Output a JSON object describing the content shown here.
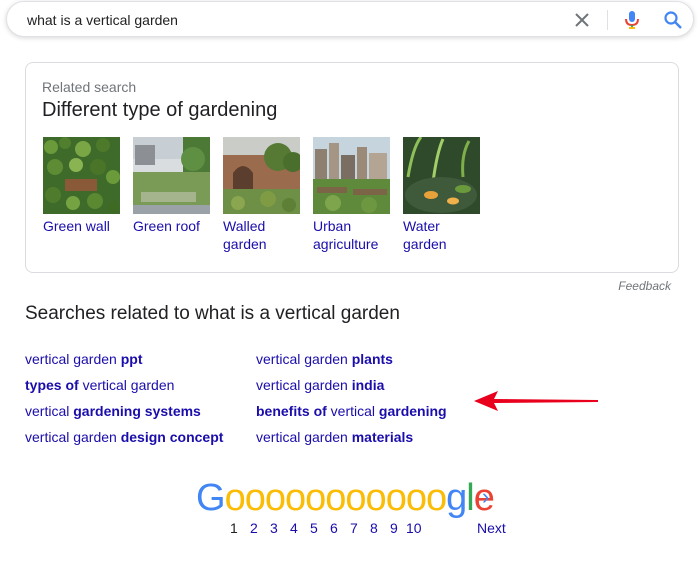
{
  "search": {
    "query": "what is a vertical garden",
    "clear_icon": "close-icon",
    "mic_icon": "microphone-icon",
    "search_icon": "search-icon"
  },
  "related_card": {
    "kicker": "Related search",
    "title": "Different type of gardening",
    "items": [
      {
        "label_line1": "Green wall",
        "label_line2": ""
      },
      {
        "label_line1": "Green roof",
        "label_line2": ""
      },
      {
        "label_line1": "Walled",
        "label_line2": "garden"
      },
      {
        "label_line1": "Urban",
        "label_line2": "agriculture"
      },
      {
        "label_line1": "Water",
        "label_line2": "garden"
      }
    ]
  },
  "feedback": "Feedback",
  "related_searches": {
    "heading": "Searches related to what is a vertical garden",
    "links": [
      [
        "vertical garden ",
        "ppt",
        ""
      ],
      [
        "",
        "types of",
        " vertical garden"
      ],
      [
        "vertical ",
        "gardening systems",
        ""
      ],
      [
        "vertical garden ",
        "design concept",
        ""
      ],
      [
        "vertical garden ",
        "plants",
        ""
      ],
      [
        "vertical garden ",
        "india",
        ""
      ],
      [
        "",
        "benefits of",
        " vertical ",
        "gardening"
      ],
      [
        "vertical garden ",
        "materials",
        ""
      ]
    ]
  },
  "pagination": {
    "logo_letters": [
      "G",
      "o",
      "o",
      "o",
      "o",
      "o",
      "o",
      "o",
      "o",
      "o",
      "o",
      "o",
      "g",
      "l",
      "e"
    ],
    "pages": [
      "1",
      "2",
      "3",
      "4",
      "5",
      "6",
      "7",
      "8",
      "9",
      "10"
    ],
    "current_page": "1",
    "next_label": "Next",
    "next_icon": "chevron-right-icon"
  },
  "colors": {
    "link": "#1a0dab",
    "arrow": "#e8001c",
    "google_blue": "#4285f4",
    "google_red": "#ea4335",
    "google_yellow": "#fbbc05",
    "google_green": "#34a853"
  }
}
